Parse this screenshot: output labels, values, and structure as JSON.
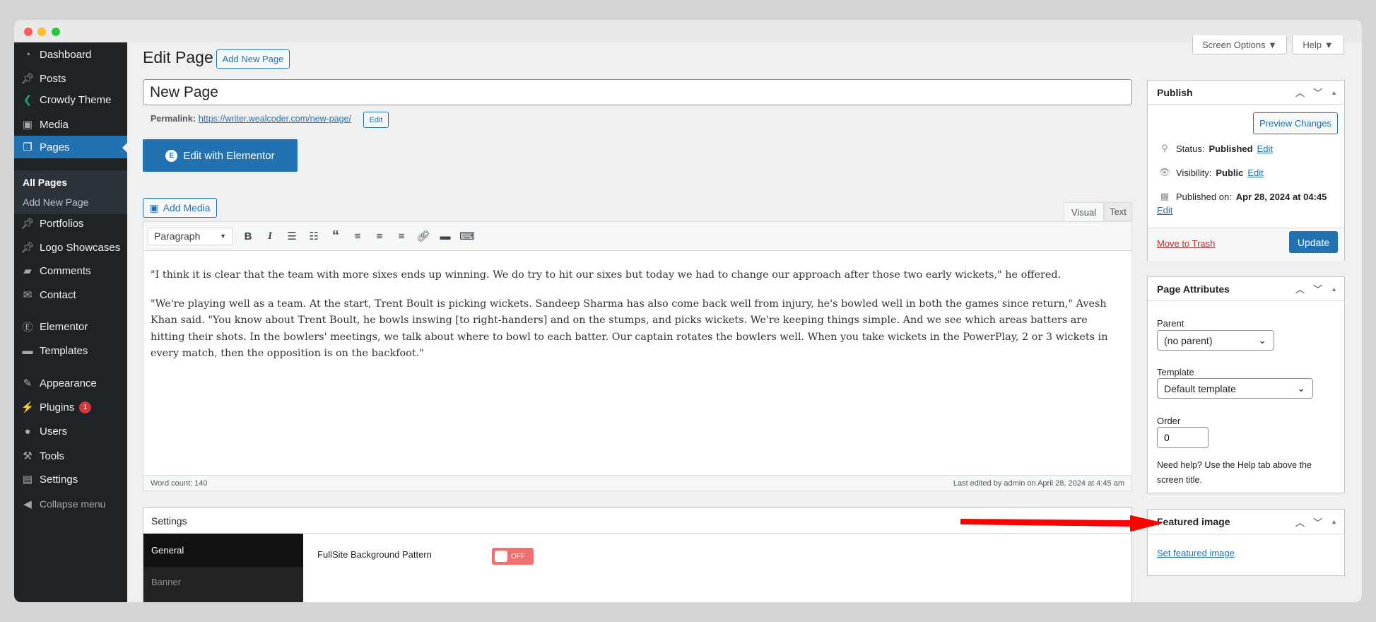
{
  "window": {
    "controls": [
      "close",
      "minimize",
      "maximize"
    ],
    "colors": {
      "close": "#fe5f57",
      "minimize": "#febc2e",
      "maximize": "#28c840"
    }
  },
  "sidebar": {
    "items": [
      {
        "label": "Dashboard",
        "icon": "dashboard-icon"
      },
      {
        "label": "Posts",
        "icon": "pin-icon"
      },
      {
        "label": "Crowdy Theme",
        "icon": "crowdy-logo-icon"
      },
      {
        "label": "Media",
        "icon": "media-icon"
      },
      {
        "label": "Pages",
        "icon": "pages-icon",
        "active": true
      },
      {
        "label": "Portfolios",
        "icon": "pin-icon"
      },
      {
        "label": "Logo Showcases",
        "icon": "pin-icon"
      },
      {
        "label": "Comments",
        "icon": "comment-icon"
      },
      {
        "label": "Contact",
        "icon": "mail-icon"
      },
      {
        "label": "Elementor",
        "icon": "elementor-icon"
      },
      {
        "label": "Templates",
        "icon": "folder-icon"
      },
      {
        "label": "Appearance",
        "icon": "brush-icon"
      },
      {
        "label": "Plugins",
        "icon": "plugin-icon",
        "badge": "1"
      },
      {
        "label": "Users",
        "icon": "user-icon"
      },
      {
        "label": "Tools",
        "icon": "wrench-icon"
      },
      {
        "label": "Settings",
        "icon": "settings-icon"
      },
      {
        "label": "Collapse menu",
        "icon": "collapse-icon"
      }
    ],
    "submenu": [
      "All Pages",
      "Add New Page"
    ]
  },
  "header": {
    "title": "Edit Page",
    "add_new": "Add New Page",
    "screen_options": "Screen Options ▼",
    "help": "Help ▼"
  },
  "post": {
    "title": "New Page",
    "permalink_label": "Permalink:",
    "permalink": "https://writer.wealcoder.com/new-page/",
    "permalink_edit": "Edit",
    "elementor_button": "Edit with Elementor"
  },
  "editor": {
    "add_media": "Add Media",
    "tabs": [
      "Visual",
      "Text"
    ],
    "format": "Paragraph",
    "paragraphs": [
      "\"I think it is clear that the team with more sixes ends up winning. We do try to hit our sixes but today we had to change our approach after those two early wickets,\" he offered.",
      "\"We're playing well as a team. At the start, Trent Boult is picking wickets. Sandeep Sharma has also come back well from injury, he's bowled well in both the games since return,\" Avesh Khan said. \"You know about Trent Boult, he bowls inswing [to right-handers] and on the stumps, and picks wickets. We're keeping things simple. And we see which areas batters are hitting their shots. In the bowlers' meetings, we talk about where to bowl to each batter. Our captain rotates the bowlers well. When you take wickets in the PowerPlay, 2 or 3 wickets in every match, then the opposition is on the backfoot.\""
    ],
    "word_count": "Word count: 140",
    "last_edited": "Last edited by admin on April 28, 2024 at 4:45 am"
  },
  "settings_box": {
    "title": "Settings",
    "tabs": [
      "General",
      "Banner"
    ],
    "field_label": "FullSite Background Pattern",
    "toggle": "OFF",
    "toggle_color": "#f07070"
  },
  "publish": {
    "title": "Publish",
    "preview": "Preview Changes",
    "status_label": "Status:",
    "status": "Published",
    "visibility_label": "Visibility:",
    "visibility": "Public",
    "published_label": "Published on:",
    "published": "Apr 28, 2024 at 04:45",
    "edit": "Edit",
    "trash": "Move to Trash",
    "update": "Update"
  },
  "attributes": {
    "title": "Page Attributes",
    "parent_label": "Parent",
    "parent": "(no parent)",
    "template_label": "Template",
    "template": "Default template",
    "order_label": "Order",
    "order": "0",
    "help": "Need help? Use the Help tab above the screen title."
  },
  "featured": {
    "title": "Featured image",
    "link": "Set featured image"
  },
  "annotation": {
    "arrow_color": "#ff0000"
  }
}
